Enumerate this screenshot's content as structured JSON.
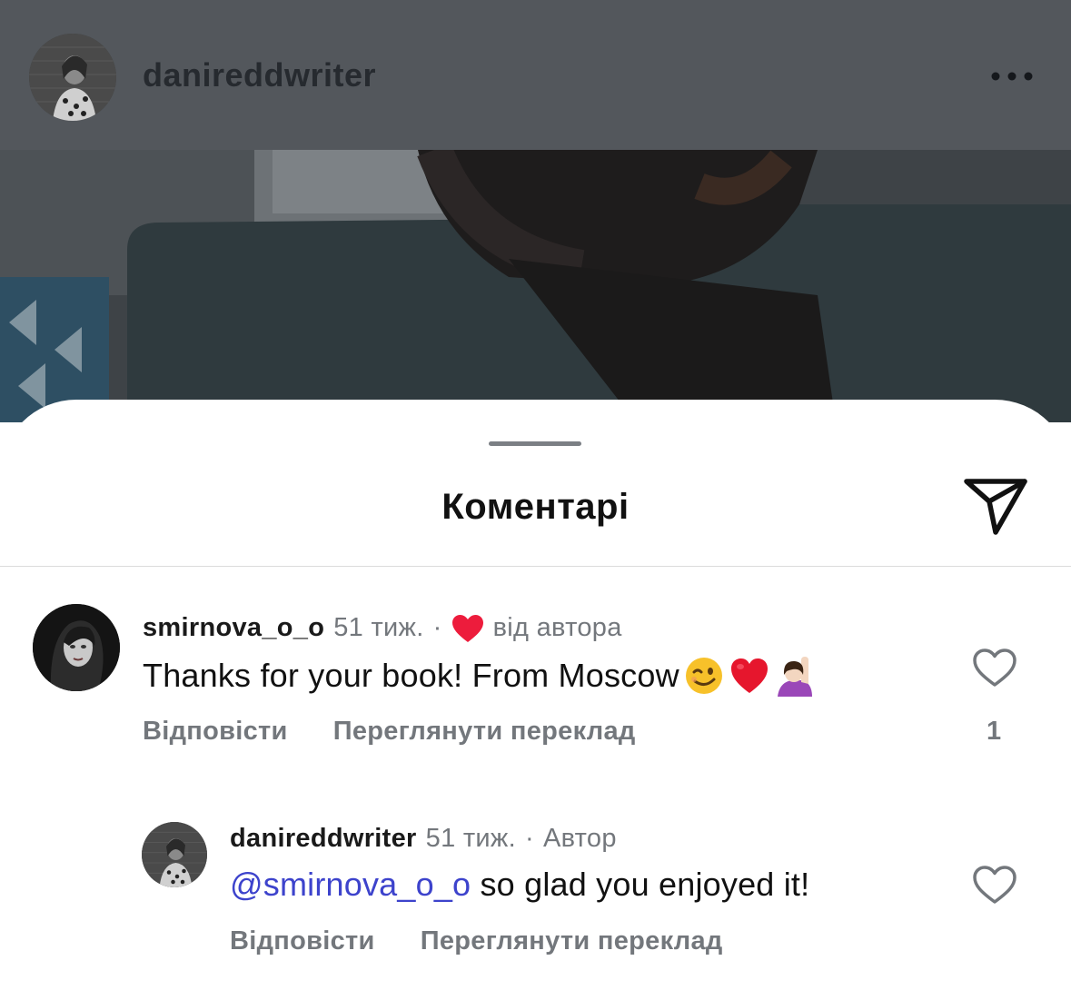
{
  "header": {
    "username": "danireddwriter",
    "more_icon": "more-horizontal-icon"
  },
  "sheet": {
    "title": "Коментарі",
    "share_icon": "paper-plane-icon"
  },
  "comments": [
    {
      "username": "smirnova_o_o",
      "time": "51 тиж.",
      "separator": "·",
      "liked_by_author_label": "від автора",
      "text": "Thanks for your book! From Moscow",
      "emojis": [
        "wink-emoji",
        "red-heart-emoji",
        "raising-hand-emoji"
      ],
      "reply_label": "Відповісти",
      "translate_label": "Переглянути переклад",
      "like_count": "1"
    },
    {
      "username": "danireddwriter",
      "time": "51 тиж.",
      "separator": "·",
      "author_badge": "Автор",
      "mention": "@smirnova_o_o",
      "text": " so glad you enjoyed it!",
      "reply_label": "Відповісти",
      "translate_label": "Переглянути переклад"
    }
  ],
  "colors": {
    "mention": "#3d43cc",
    "liked_heart": "#ed1c3c",
    "secondary_text": "#73777c",
    "overlay": "#53575c"
  }
}
